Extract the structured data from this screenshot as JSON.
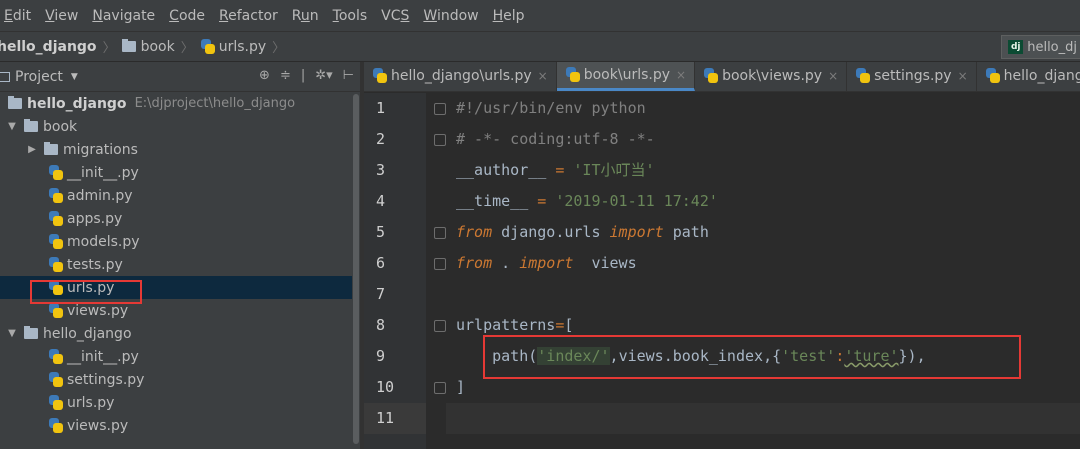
{
  "menubar": {
    "items": [
      "Edit",
      "View",
      "Navigate",
      "Code",
      "Refactor",
      "Run",
      "Tools",
      "VCS",
      "Window",
      "Help"
    ],
    "mnemonics": [
      "E",
      "V",
      "N",
      "C",
      "R",
      "u",
      "T",
      "S",
      "W",
      "H"
    ]
  },
  "breadcrumb": {
    "items": [
      "hello_django",
      "book",
      "urls.py"
    ],
    "run_config": "hello_dj"
  },
  "project_panel": {
    "title": "Project",
    "tree": [
      {
        "label": "hello_django",
        "path": "E:\\djproject\\hello_django",
        "type": "root"
      },
      {
        "label": "book",
        "type": "folder",
        "expanded": true
      },
      {
        "label": "migrations",
        "type": "folder",
        "expanded": false
      },
      {
        "label": "__init__.py",
        "type": "py"
      },
      {
        "label": "admin.py",
        "type": "py"
      },
      {
        "label": "apps.py",
        "type": "py"
      },
      {
        "label": "models.py",
        "type": "py"
      },
      {
        "label": "tests.py",
        "type": "py"
      },
      {
        "label": "urls.py",
        "type": "py",
        "selected": true
      },
      {
        "label": "views.py",
        "type": "py"
      },
      {
        "label": "hello_django",
        "type": "folder",
        "expanded": true
      },
      {
        "label": "__init__.py",
        "type": "py"
      },
      {
        "label": "settings.py",
        "type": "py"
      },
      {
        "label": "urls.py",
        "type": "py"
      },
      {
        "label": "views.py",
        "type": "py"
      }
    ]
  },
  "tabs": [
    {
      "label": "hello_django\\urls.py",
      "active": false
    },
    {
      "label": "book\\urls.py",
      "active": true
    },
    {
      "label": "book\\views.py",
      "active": false
    },
    {
      "label": "settings.py",
      "active": false
    },
    {
      "label": "hello_django\\",
      "active": false
    }
  ],
  "editor": {
    "line_numbers": [
      "1",
      "2",
      "3",
      "4",
      "5",
      "6",
      "7",
      "8",
      "9",
      "10",
      "11"
    ],
    "line1": "#!/usr/bin/env python",
    "line2": "# -*- coding:utf-8 -*-",
    "author_name": "__author__",
    "author_value": "'IT小叮当'",
    "time_name": "__time__",
    "time_value": "'2019-01-11 17:42'",
    "from_kw": "from",
    "module1": " django.urls ",
    "import_kw": "import",
    "name1": " path",
    "module2": " . ",
    "name2": "  views",
    "urlpatterns": "urlpatterns",
    "assign": "=",
    "open_bracket": "[",
    "path_fn": "path",
    "route_str": "'index/'",
    "view_ref": "views.book_index",
    "dict_key": "'test'",
    "dict_colon": ":",
    "dict_value": "'ture'",
    "close_bracket": "]",
    "eq": " = "
  },
  "colors": {
    "background": "#2b2b2b",
    "panel": "#3c3f41",
    "keyword": "#cc7832",
    "string": "#6a8759",
    "comment": "#808080",
    "highlight_box": "#e53935"
  }
}
